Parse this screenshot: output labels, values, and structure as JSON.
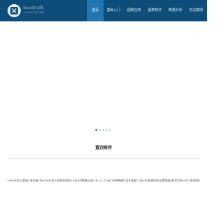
{
  "brand": {
    "title": "Excel办公网",
    "subtitle": "excel办公技巧教程"
  },
  "nav": {
    "items": [
      {
        "label": "首页",
        "active": true
      },
      {
        "label": "基础入门",
        "active": false
      },
      {
        "label": "函数应用",
        "active": false
      },
      {
        "label": "图表制作",
        "active": false
      },
      {
        "label": "数据分析",
        "active": false
      },
      {
        "label": "实战案例",
        "active": false
      }
    ]
  },
  "carousel": {
    "slide_count": 5,
    "active_index": 0
  },
  "section": {
    "title": "置顶推荐"
  },
  "feed": {
    "items": [
      "[excel怎么筛选] 多项参数...",
      "[excel开发] 高效收纳办公...",
      "[excel数据分析] 从入门到...",
      "[excel快捷键大全] 高效办...",
      "[excel表格如何设置数据...",
      "图片转Excel] 高效转换表..."
    ]
  },
  "colors": {
    "topbar": "#0d4d7a",
    "nav_active": "#1f78b4",
    "dot_active": "#2a86c6"
  }
}
